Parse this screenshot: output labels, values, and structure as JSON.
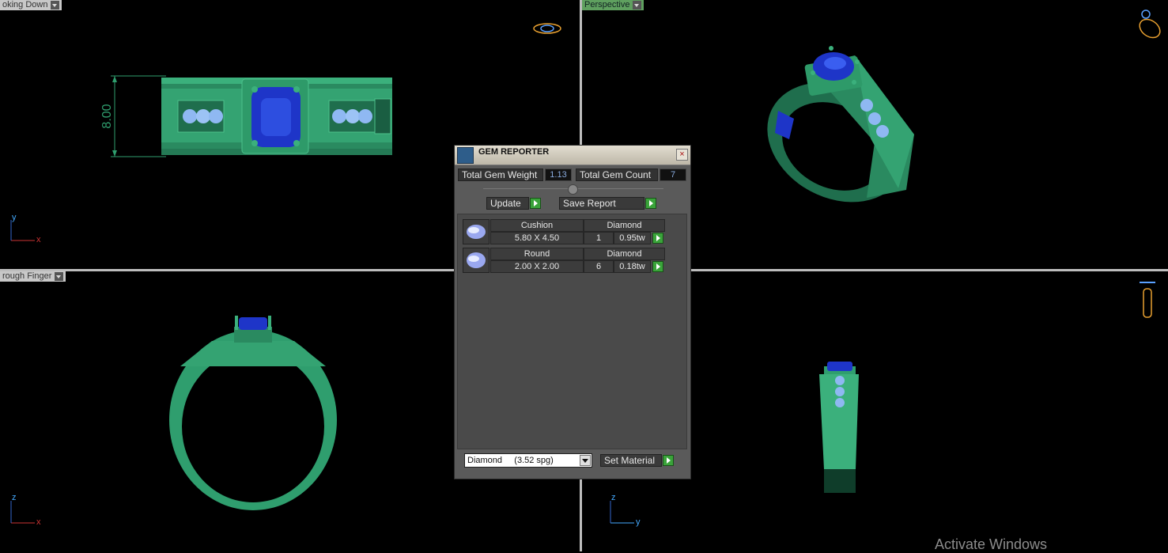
{
  "viewports": {
    "top_left": {
      "label": "oking Down",
      "dimension": "8.00",
      "axis_v": "y",
      "axis_h": "x"
    },
    "top_right": {
      "label": "Perspective"
    },
    "bottom_left": {
      "label": "rough Finger",
      "axis_v": "z",
      "axis_h": "x"
    },
    "bottom_right": {
      "axis_v": "z",
      "axis_h": "y"
    }
  },
  "gem_reporter": {
    "title": "GEM REPORTER",
    "total_weight_label": "Total Gem Weight",
    "total_weight_value": "1.13",
    "total_count_label": "Total Gem Count",
    "total_count_value": "7",
    "update_label": "Update",
    "save_report_label": "Save Report",
    "gems": [
      {
        "shape": "Cushion",
        "material": "Diamond",
        "size": "5.80 X 4.50",
        "count": "1",
        "weight": "0.95tw"
      },
      {
        "shape": "Round",
        "material": "Diamond",
        "size": "2.00 X 2.00",
        "count": "6",
        "weight": "0.18tw"
      }
    ],
    "material_select": "Diamond     (3.52 spg)",
    "set_material_label": "Set Material"
  },
  "watermark": "Activate Windows",
  "colors": {
    "metal": "#2f9e6e",
    "gem": "#1e35c8",
    "small_gem": "#8fb8f2",
    "highlight": "#3aa33a"
  }
}
